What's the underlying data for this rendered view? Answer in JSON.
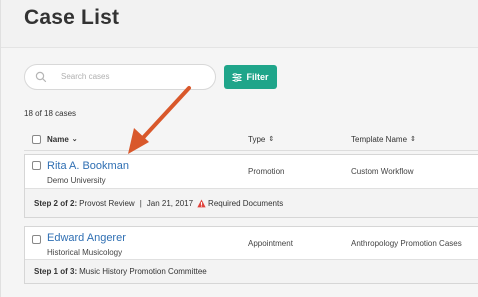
{
  "header": {
    "title": "Case List"
  },
  "search": {
    "placeholder": "Search cases"
  },
  "toolbar": {
    "filter_label": "Filter"
  },
  "results": {
    "count_text": "18 of 18 cases"
  },
  "columns": {
    "name": "Name",
    "type": "Type",
    "template": "Template Name"
  },
  "cases": [
    {
      "name": "Rita A. Bookman",
      "unit": "Demo University",
      "type": "Promotion",
      "template": "Custom Workflow",
      "step_prefix": "Step 2 of 2:",
      "step_text": "Provost Review",
      "date": "Jan 21, 2017",
      "alert": "Required Documents"
    },
    {
      "name": "Edward Angerer",
      "unit": "Historical Musicology",
      "type": "Appointment",
      "template": "Anthropology Promotion Cases",
      "step_prefix": "Step 1 of 3:",
      "step_text": "Music History Promotion Committee"
    }
  ],
  "colors": {
    "accent": "#1fa58a",
    "link": "#2f6fb3",
    "annotation": "#d9582b",
    "warning": "#e0433c"
  }
}
